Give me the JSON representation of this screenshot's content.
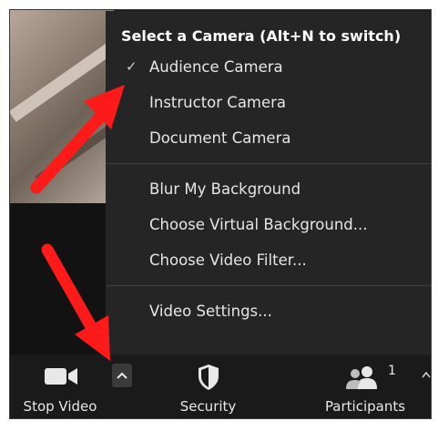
{
  "menu": {
    "header": "Select a Camera (Alt+N to switch)",
    "check_glyph": "✓",
    "cameras": [
      {
        "label": "Audience Camera",
        "selected": true
      },
      {
        "label": "Instructor Camera",
        "selected": false
      },
      {
        "label": "Document Camera",
        "selected": false
      }
    ],
    "background_items": [
      {
        "label": "Blur My Background"
      },
      {
        "label": "Choose Virtual Background..."
      },
      {
        "label": "Choose Video Filter..."
      }
    ],
    "settings_item": {
      "label": "Video Settings..."
    }
  },
  "toolbar": {
    "stop_video_label": "Stop Video",
    "security_label": "Security",
    "participants_label": "Participants",
    "participants_count": "1"
  },
  "colors": {
    "menu_bg": "#252525",
    "toolbar_bg": "#1a1a1a",
    "arrow": "#ff1a1a"
  },
  "icons": {
    "check": "check-icon",
    "video": "video-camera-icon",
    "caret": "chevron-up-icon",
    "security": "shield-icon",
    "participants": "participants-icon"
  }
}
